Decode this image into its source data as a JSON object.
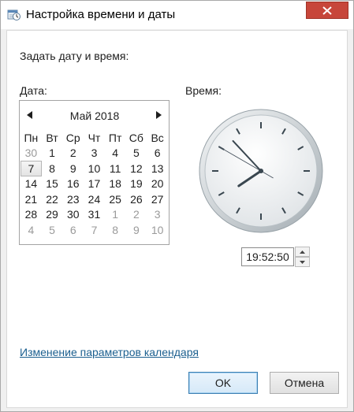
{
  "window": {
    "title": "Настройка времени и даты",
    "close_icon": "close-icon",
    "app_icon": "date-time-settings-icon"
  },
  "dialog": {
    "heading": "Задать дату и время:",
    "date_label": "Дата:",
    "time_label": "Время:"
  },
  "calendar": {
    "month_label": "Май 2018",
    "prev_icon": "triangle-left-icon",
    "next_icon": "triangle-right-icon",
    "weekdays": [
      "Пн",
      "Вт",
      "Ср",
      "Чт",
      "Пт",
      "Сб",
      "Вс"
    ],
    "weeks": [
      [
        {
          "d": "30",
          "other": true
        },
        {
          "d": "1"
        },
        {
          "d": "2"
        },
        {
          "d": "3"
        },
        {
          "d": "4"
        },
        {
          "d": "5"
        },
        {
          "d": "6"
        }
      ],
      [
        {
          "d": "7",
          "today": true
        },
        {
          "d": "8"
        },
        {
          "d": "9"
        },
        {
          "d": "10"
        },
        {
          "d": "11"
        },
        {
          "d": "12"
        },
        {
          "d": "13"
        }
      ],
      [
        {
          "d": "14"
        },
        {
          "d": "15"
        },
        {
          "d": "16"
        },
        {
          "d": "17"
        },
        {
          "d": "18"
        },
        {
          "d": "19"
        },
        {
          "d": "20"
        }
      ],
      [
        {
          "d": "21"
        },
        {
          "d": "22"
        },
        {
          "d": "23"
        },
        {
          "d": "24"
        },
        {
          "d": "25"
        },
        {
          "d": "26"
        },
        {
          "d": "27"
        }
      ],
      [
        {
          "d": "28"
        },
        {
          "d": "29"
        },
        {
          "d": "30"
        },
        {
          "d": "31"
        },
        {
          "d": "1",
          "other": true
        },
        {
          "d": "2",
          "other": true
        },
        {
          "d": "3",
          "other": true
        }
      ],
      [
        {
          "d": "4",
          "other": true
        },
        {
          "d": "5",
          "other": true
        },
        {
          "d": "6",
          "other": true
        },
        {
          "d": "7",
          "other": true
        },
        {
          "d": "8",
          "other": true
        },
        {
          "d": "9",
          "other": true
        },
        {
          "d": "10",
          "other": true
        }
      ]
    ]
  },
  "clock": {
    "hours": 19,
    "minutes": 52,
    "seconds": 50
  },
  "time": {
    "value": "19:52:50",
    "spin_up_icon": "chevron-up-icon",
    "spin_down_icon": "chevron-down-icon"
  },
  "footer": {
    "calendar_link": "Изменение параметров календаря",
    "ok_label": "OK",
    "cancel_label": "Отмена"
  },
  "colors": {
    "close_button": "#c7463a",
    "link": "#1b5f8f",
    "default_button_border": "#3c7fb1"
  }
}
